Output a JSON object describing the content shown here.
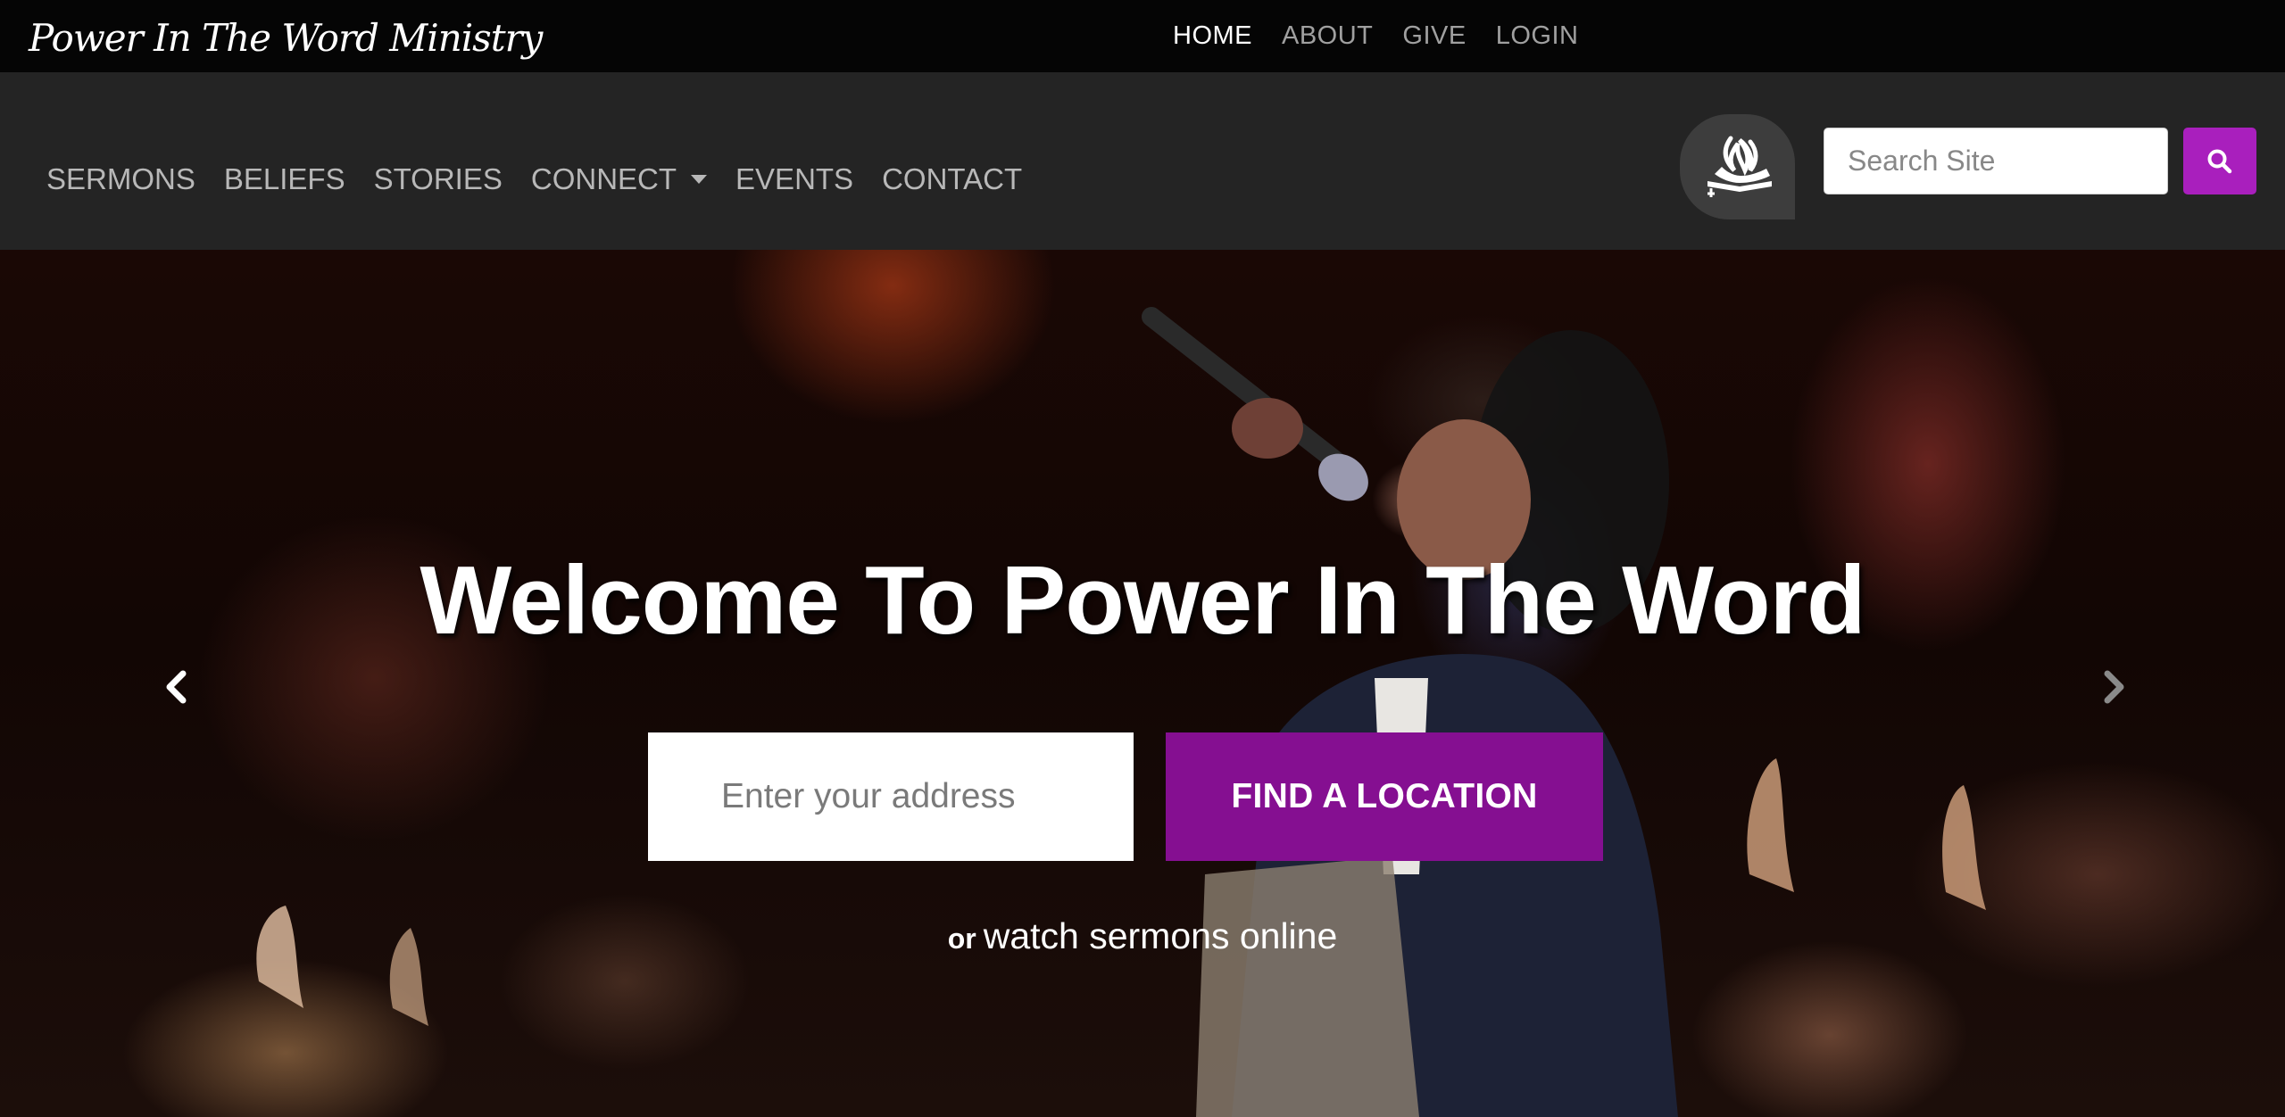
{
  "brand": {
    "name": "Power In The Word Ministry"
  },
  "top_nav": [
    {
      "label": "HOME",
      "active": true
    },
    {
      "label": "ABOUT",
      "active": false
    },
    {
      "label": "GIVE",
      "active": false
    },
    {
      "label": "LOGIN",
      "active": false
    }
  ],
  "main_nav": [
    {
      "label": "SERMONS"
    },
    {
      "label": "BELIEFS"
    },
    {
      "label": "STORIES"
    },
    {
      "label": "CONNECT",
      "dropdown": true
    },
    {
      "label": "EVENTS"
    },
    {
      "label": "CONTACT"
    }
  ],
  "search": {
    "placeholder": "Search Site",
    "value": "",
    "button_icon": "search-icon"
  },
  "hero": {
    "title": "Welcome To Power In The Word",
    "address_placeholder": "Enter your address",
    "find_button": "FIND A LOCATION",
    "or_text": "or",
    "watch_link": "watch sermons online"
  },
  "colors": {
    "accent": "#a91fbd",
    "find_button": "#850f91",
    "top_bar": "#050505",
    "nav_bar": "#242424"
  }
}
